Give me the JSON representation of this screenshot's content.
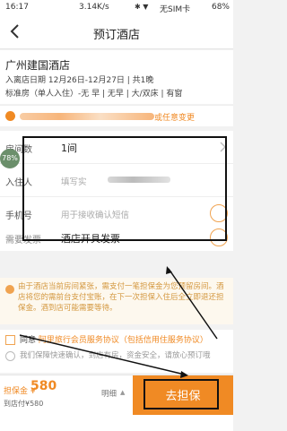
{
  "status_bar": {
    "time": "16:17",
    "network": "3.14K/s",
    "carrier": "无SIM卡",
    "battery": "68%"
  },
  "nav": {
    "title": "预订酒店"
  },
  "hotel": {
    "name": "广州建国酒店",
    "dates": "入离店日期 12月26日-12月27日 | 共1晚",
    "room": "标准房（单人入住）-无 早 | 无早 | 大/双床 | 有窗"
  },
  "cancel_policy": {
    "text": "或任意变更"
  },
  "form": {
    "rooms": {
      "label": "房间数",
      "value": "1间"
    },
    "guest": {
      "label": "入住人",
      "placeholder": "填写实"
    },
    "phone": {
      "label": "手机号",
      "placeholder": "用于接收确认短信"
    },
    "tag_text": "78%"
  },
  "invoice": {
    "label": "需要发票",
    "value": "酒店开具发票"
  },
  "notice": {
    "text": "由于酒店当前房间紧张，需支付一笔担保金为您预留房间。酒店将您的需前台支付宝账，在下一次担保入住后全立即退还担保金。酒到店可能需要等待。"
  },
  "agreement": {
    "prefix": "同意",
    "link": "阿里旅行会员服务协议（包括信用住服务协议）",
    "note": "我们保障快速确认，到店有房，资金安全，请放心预订哦"
  },
  "bottom": {
    "pay_label": "担保金 ¥",
    "pay_amount": "580",
    "total": "到店付¥580",
    "detail": "明细",
    "cta": "去担保"
  },
  "colors": {
    "accent": "#f08a24",
    "notice_bg": "#fdf8ee",
    "annotation": "#111111"
  }
}
